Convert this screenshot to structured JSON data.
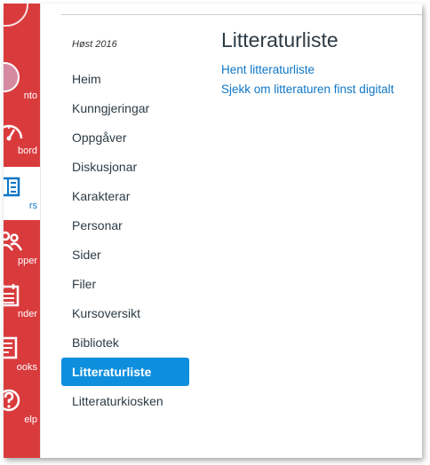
{
  "global_nav": {
    "items": [
      {
        "label": "nto",
        "icon": "user-avatar"
      },
      {
        "label": "bord",
        "icon": "dashboard-icon"
      },
      {
        "label": "rs",
        "icon": "courses-icon",
        "active": true
      },
      {
        "label": "pper",
        "icon": "groups-icon"
      },
      {
        "label": "nder",
        "icon": "calendar-icon"
      },
      {
        "label": "ooks",
        "icon": "books-icon"
      },
      {
        "label": "elp",
        "icon": "help-icon"
      }
    ],
    "color": "#d93b3d"
  },
  "course_nav": {
    "term": "Høst 2016",
    "items": [
      {
        "label": "Heim"
      },
      {
        "label": "Kunngjeringar"
      },
      {
        "label": "Oppgåver"
      },
      {
        "label": "Diskusjonar"
      },
      {
        "label": "Karakterar"
      },
      {
        "label": "Personar"
      },
      {
        "label": "Sider"
      },
      {
        "label": "Filer"
      },
      {
        "label": "Kursoversikt"
      },
      {
        "label": "Bibliotek"
      },
      {
        "label": "Litteraturliste",
        "active": true
      },
      {
        "label": "Litteraturkiosken"
      }
    ],
    "active_color": "#0e8fde"
  },
  "main": {
    "title": "Litteraturliste",
    "links": [
      {
        "label": "Hent litteraturliste"
      },
      {
        "label": "Sjekk om litteraturen finst digitalt"
      }
    ],
    "link_color": "#0e76c7"
  }
}
